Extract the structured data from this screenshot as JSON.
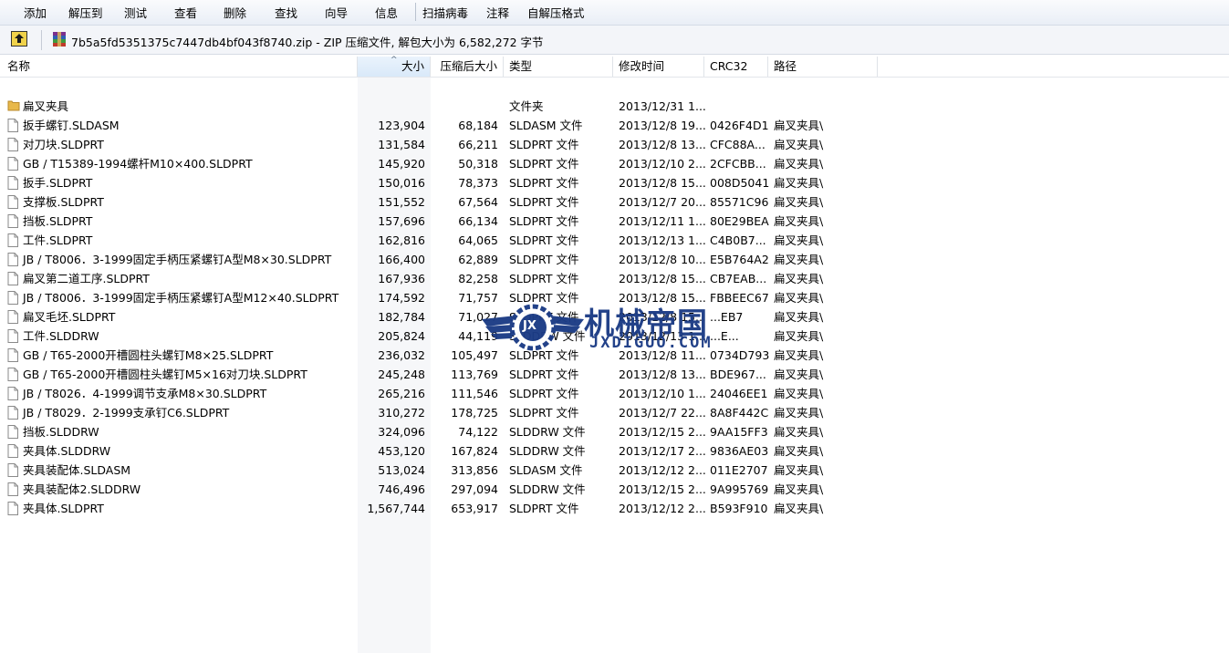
{
  "toolbar": {
    "buttons": [
      "添加",
      "解压到",
      "测试",
      "查看",
      "删除",
      "查找",
      "向导",
      "信息",
      "扫描病毒",
      "注释",
      "自解压格式"
    ]
  },
  "address": {
    "text": "7b5a5fd5351375c7447db4bf043f8740.zip - ZIP 压缩文件, 解包大小为 6,582,272 字节"
  },
  "columns": {
    "name": "名称",
    "size": "大小",
    "packed": "压缩后大小",
    "type": "类型",
    "modified": "修改时间",
    "crc": "CRC32",
    "path": "路径"
  },
  "rows": [
    {
      "icon": "folder-icon",
      "name": "扁叉夹具",
      "size": "",
      "packed": "",
      "type": "文件夹",
      "modified": "2013/12/31 1...",
      "crc": "",
      "path": ""
    },
    {
      "icon": "file-icon",
      "name": "扳手螺钉.SLDASM",
      "size": "123,904",
      "packed": "68,184",
      "type": "SLDASM 文件",
      "modified": "2013/12/8 19...",
      "crc": "0426F4D1",
      "path": "扁叉夹具\\"
    },
    {
      "icon": "file-icon",
      "name": "对刀块.SLDPRT",
      "size": "131,584",
      "packed": "66,211",
      "type": "SLDPRT 文件",
      "modified": "2013/12/8 13...",
      "crc": "CFC88A...",
      "path": "扁叉夹具\\"
    },
    {
      "icon": "file-icon",
      "name": "GB / T15389-1994螺杆M10×400.SLDPRT",
      "size": "145,920",
      "packed": "50,318",
      "type": "SLDPRT 文件",
      "modified": "2013/12/10 2...",
      "crc": "2CFCBB...",
      "path": "扁叉夹具\\"
    },
    {
      "icon": "file-icon",
      "name": "扳手.SLDPRT",
      "size": "150,016",
      "packed": "78,373",
      "type": "SLDPRT 文件",
      "modified": "2013/12/8 15...",
      "crc": "008D5041",
      "path": "扁叉夹具\\"
    },
    {
      "icon": "file-icon",
      "name": "支撑板.SLDPRT",
      "size": "151,552",
      "packed": "67,564",
      "type": "SLDPRT 文件",
      "modified": "2013/12/7 20...",
      "crc": "85571C96",
      "path": "扁叉夹具\\"
    },
    {
      "icon": "file-icon",
      "name": "挡板.SLDPRT",
      "size": "157,696",
      "packed": "66,134",
      "type": "SLDPRT 文件",
      "modified": "2013/12/11 1...",
      "crc": "80E29BEA",
      "path": "扁叉夹具\\"
    },
    {
      "icon": "file-icon",
      "name": "工件.SLDPRT",
      "size": "162,816",
      "packed": "64,065",
      "type": "SLDPRT 文件",
      "modified": "2013/12/13 1...",
      "crc": "C4B0B7...",
      "path": "扁叉夹具\\"
    },
    {
      "icon": "file-icon",
      "name": "JB / T8006．3-1999固定手柄压紧螺钉A型M8×30.SLDPRT",
      "size": "166,400",
      "packed": "62,889",
      "type": "SLDPRT 文件",
      "modified": "2013/12/8 10...",
      "crc": "E5B764A2",
      "path": "扁叉夹具\\"
    },
    {
      "icon": "file-icon",
      "name": "扁叉第二道工序.SLDPRT",
      "size": "167,936",
      "packed": "82,258",
      "type": "SLDPRT 文件",
      "modified": "2013/12/8 15...",
      "crc": "CB7EAB...",
      "path": "扁叉夹具\\"
    },
    {
      "icon": "file-icon",
      "name": "JB / T8006．3-1999固定手柄压紧螺钉A型M12×40.SLDPRT",
      "size": "174,592",
      "packed": "71,757",
      "type": "SLDPRT 文件",
      "modified": "2013/12/8 15...",
      "crc": "FBBEEC67",
      "path": "扁叉夹具\\"
    },
    {
      "icon": "file-icon",
      "name": "扁叉毛坯.SLDPRT",
      "size": "182,784",
      "packed": "71,027",
      "type": "SLDPRT 文件",
      "modified": "2013/12/8 15...",
      "crc": "...EB7",
      "path": "扁叉夹具\\"
    },
    {
      "icon": "file-icon",
      "name": "工件.SLDDRW",
      "size": "205,824",
      "packed": "44,119",
      "type": "SLDDRW 文件",
      "modified": "2013/12/13 1...",
      "crc": "...E...",
      "path": "扁叉夹具\\"
    },
    {
      "icon": "file-icon",
      "name": "GB / T65-2000开槽圆柱头螺钉M8×25.SLDPRT",
      "size": "236,032",
      "packed": "105,497",
      "type": "SLDPRT 文件",
      "modified": "2013/12/8 11...",
      "crc": "0734D793",
      "path": "扁叉夹具\\"
    },
    {
      "icon": "file-icon",
      "name": "GB / T65-2000开槽圆柱头螺钉M5×16对刀块.SLDPRT",
      "size": "245,248",
      "packed": "113,769",
      "type": "SLDPRT 文件",
      "modified": "2013/12/8 13...",
      "crc": "BDE967...",
      "path": "扁叉夹具\\"
    },
    {
      "icon": "file-icon",
      "name": "JB / T8026．4-1999调节支承M8×30.SLDPRT",
      "size": "265,216",
      "packed": "111,546",
      "type": "SLDPRT 文件",
      "modified": "2013/12/10 1...",
      "crc": "24046EE1",
      "path": "扁叉夹具\\"
    },
    {
      "icon": "file-icon",
      "name": "JB / T8029．2-1999支承钉C6.SLDPRT",
      "size": "310,272",
      "packed": "178,725",
      "type": "SLDPRT 文件",
      "modified": "2013/12/7 22...",
      "crc": "8A8F442C",
      "path": "扁叉夹具\\"
    },
    {
      "icon": "file-icon",
      "name": "挡板.SLDDRW",
      "size": "324,096",
      "packed": "74,122",
      "type": "SLDDRW 文件",
      "modified": "2013/12/15 2...",
      "crc": "9AA15FF3",
      "path": "扁叉夹具\\"
    },
    {
      "icon": "file-icon",
      "name": "夹具体.SLDDRW",
      "size": "453,120",
      "packed": "167,824",
      "type": "SLDDRW 文件",
      "modified": "2013/12/17 2...",
      "crc": "9836AE03",
      "path": "扁叉夹具\\"
    },
    {
      "icon": "file-icon",
      "name": "夹具装配体.SLDASM",
      "size": "513,024",
      "packed": "313,856",
      "type": "SLDASM 文件",
      "modified": "2013/12/12 2...",
      "crc": "011E2707",
      "path": "扁叉夹具\\"
    },
    {
      "icon": "file-icon",
      "name": "夹具装配体2.SLDDRW",
      "size": "746,496",
      "packed": "297,094",
      "type": "SLDDRW 文件",
      "modified": "2013/12/15 2...",
      "crc": "9A995769",
      "path": "扁叉夹具\\"
    },
    {
      "icon": "file-icon",
      "name": "夹具体.SLDPRT",
      "size": "1,567,744",
      "packed": "653,917",
      "type": "SLDPRT 文件",
      "modified": "2013/12/12 2...",
      "crc": "B593F910",
      "path": "扁叉夹具\\"
    }
  ],
  "watermark": {
    "title": "机械帝国",
    "url": "JXDIGUO.COM",
    "badge": "JX"
  },
  "colors": {
    "folder": "#e8b84a",
    "sorted_header": "#d9e9f9",
    "watermark": "#1c3c86"
  }
}
